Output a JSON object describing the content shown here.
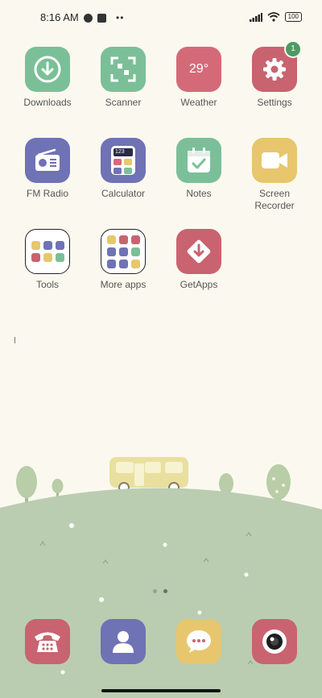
{
  "status_bar": {
    "time": "8:16 AM",
    "battery": "100",
    "more": "••"
  },
  "apps": [
    {
      "label": "Downloads",
      "icon": "download-icon",
      "color": "#7bbf98"
    },
    {
      "label": "Scanner",
      "icon": "scanner-icon",
      "color": "#7bbf98"
    },
    {
      "label": "Weather",
      "icon": "weather-icon",
      "color": "#d46a78",
      "value": "29°"
    },
    {
      "label": "Settings",
      "icon": "gear-icon",
      "color": "#c9636f",
      "badge": "1"
    },
    {
      "label": "FM Radio",
      "icon": "radio-icon",
      "color": "#6f72b4"
    },
    {
      "label": "Calculator",
      "icon": "calculator-icon",
      "color": "#6f72b4",
      "value": "123"
    },
    {
      "label": "Notes",
      "icon": "notes-icon",
      "color": "#7bbf98"
    },
    {
      "label": "Screen\nRecorder",
      "icon": "video-camera-icon",
      "color": "#e7c66d"
    },
    {
      "label": "Tools",
      "icon": "folder-icon"
    },
    {
      "label": "More apps",
      "icon": "folder-icon"
    },
    {
      "label": "GetApps",
      "icon": "getapps-icon",
      "color": "#c9636f"
    }
  ],
  "dock": [
    {
      "icon": "phone-icon",
      "color": "#c9636f"
    },
    {
      "icon": "contacts-icon",
      "color": "#6f72b4"
    },
    {
      "icon": "messages-icon",
      "color": "#e7c66d"
    },
    {
      "icon": "camera-icon",
      "color": "#c9636f"
    }
  ],
  "colors": {
    "background": "#fbf9ef",
    "hill": "#b8ccae",
    "green": "#7bbf98",
    "purple": "#6f72b4",
    "red": "#c9636f",
    "yellow": "#e7c66d"
  }
}
